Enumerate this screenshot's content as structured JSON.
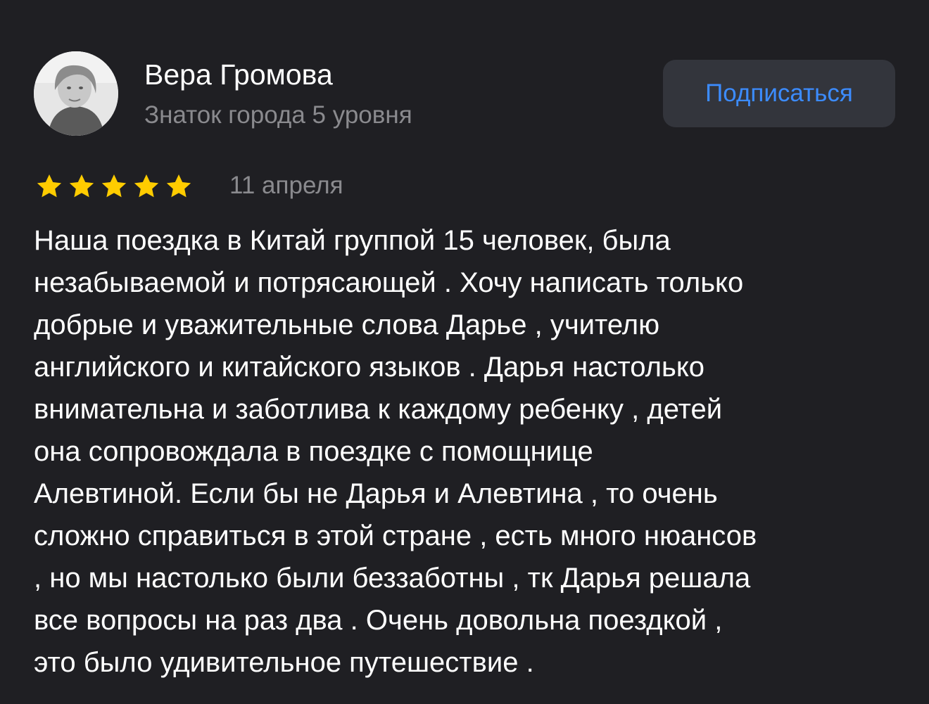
{
  "author": {
    "name": "Вера Громова",
    "level": "Знаток города 5 уровня",
    "avatar_icon": "user-photo-avatar"
  },
  "subscribe": {
    "label": "Подписаться"
  },
  "review": {
    "rating": 5,
    "max_rating": 5,
    "date": "11 апреля",
    "lines": [
      "Наша поездка в Китай группой 15 человек, была",
      "незабываемой и потрясающей . Хочу написать только",
      "добрые и уважительные слова Дарье , учителю",
      "английского и китайского языков . Дарья настолько",
      "внимательна и заботлива к каждому ребенку , детей",
      "она сопровождала в поездке с помощнице",
      "Алевтиной. Если бы не Дарья и Алевтина , то очень",
      "сложно справиться в этой стране , есть много нюансов",
      ", но мы настолько были беззаботны , тк Дарья решала",
      "все вопросы на раз два . Очень довольна поездкой ,",
      "это было удивительное путешествие ."
    ]
  },
  "colors": {
    "background": "#1f1f23",
    "star": "#ffcc00",
    "accent": "#3c8cff",
    "secondary_text": "#8a8a8e"
  }
}
